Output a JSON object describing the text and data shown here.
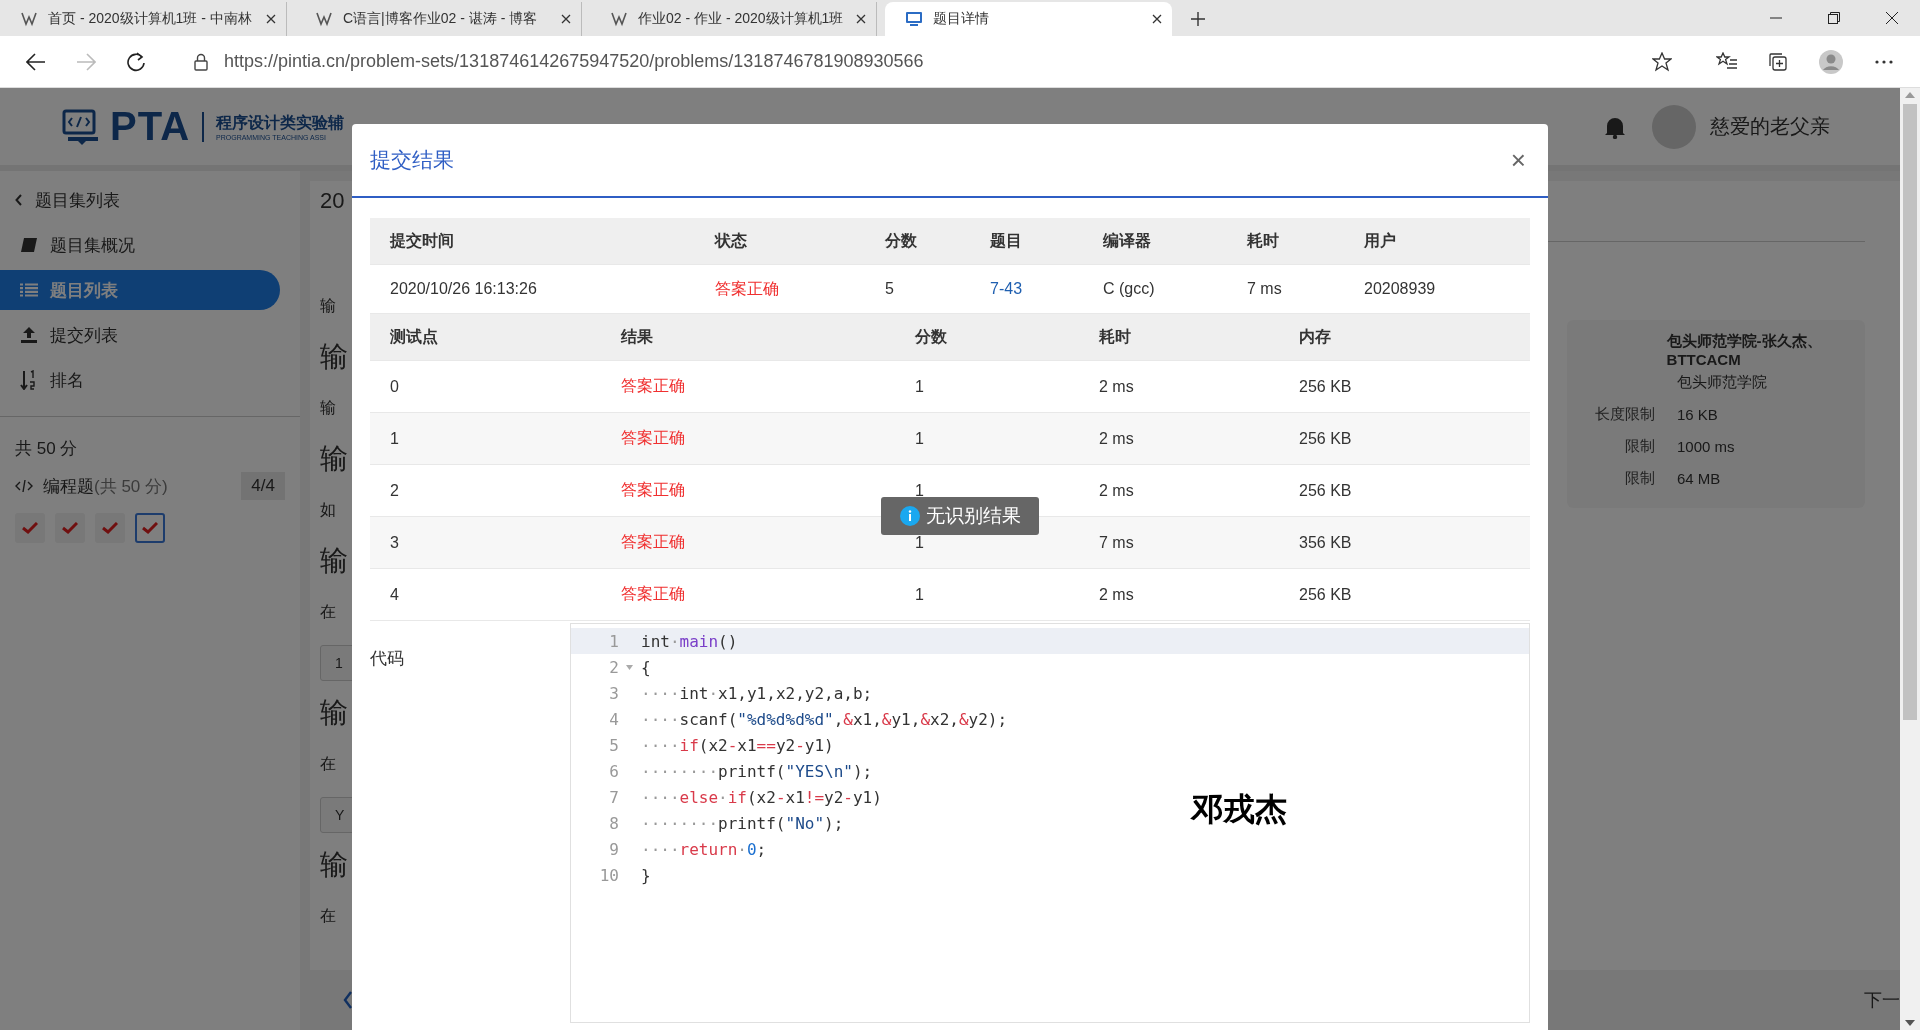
{
  "browser": {
    "tabs": [
      {
        "title": "首页 - 2020级计算机1班 - 中南林",
        "kind": "site",
        "selected": false
      },
      {
        "title": "C语言|博客作业02 - 谌涛 - 博客",
        "kind": "site",
        "selected": false
      },
      {
        "title": "作业02 - 作业 - 2020级计算机1班",
        "kind": "site",
        "selected": false
      },
      {
        "title": "题目详情",
        "kind": "app",
        "selected": true
      }
    ],
    "url": "https://pintia.cn/problem-sets/1318746142675947520/problems/1318746781908930566"
  },
  "header": {
    "logo": "PTA",
    "platform": "程序设计类实验辅",
    "platform_en": "PROGRAMMING TEACHING ASSI",
    "user": "慈爱的老父亲"
  },
  "sidebar": {
    "items": [
      {
        "label": "题目集列表",
        "kind": "back",
        "selected": false
      },
      {
        "label": "题目集概况",
        "kind": "book",
        "selected": false
      },
      {
        "label": "题目列表",
        "kind": "list",
        "selected": true
      },
      {
        "label": "提交列表",
        "kind": "upload",
        "selected": false
      },
      {
        "label": "排名",
        "kind": "sort",
        "selected": false
      }
    ],
    "total": "共 50 分",
    "section": "编程题",
    "section_score": "(共 50 分)",
    "progress": "4/4",
    "problems": [
      {
        "checked": true,
        "selected": false
      },
      {
        "checked": true,
        "selected": false
      },
      {
        "checked": true,
        "selected": false
      },
      {
        "checked": true,
        "selected": true
      }
    ]
  },
  "problem_strip": [
    {
      "text": "20",
      "kind": "title"
    },
    {
      "text": "输",
      "kind": "text"
    },
    {
      "text": "输",
      "kind": "heading"
    },
    {
      "text": "输",
      "kind": "text"
    },
    {
      "text": "输",
      "kind": "heading"
    },
    {
      "text": "如",
      "kind": "text"
    },
    {
      "text": "输",
      "kind": "heading"
    },
    {
      "text": "在",
      "kind": "text"
    },
    {
      "text": "1",
      "kind": "box"
    },
    {
      "text": "输",
      "kind": "heading"
    },
    {
      "text": "在",
      "kind": "text"
    },
    {
      "text": "Y",
      "kind": "box"
    },
    {
      "text": "输",
      "kind": "heading"
    },
    {
      "text": "在",
      "kind": "text"
    }
  ],
  "info": {
    "rows": [
      {
        "value": "包头师范学院-张久杰、BTTCACM",
        "bold": true
      },
      {
        "value": "包头师范学院",
        "bold": false
      },
      {
        "label": "长度限制",
        "value": "16 KB",
        "bold": false
      },
      {
        "label": "限制",
        "value": "1000 ms",
        "bold": false
      },
      {
        "label": "限制",
        "value": "64 MB",
        "bold": false
      }
    ]
  },
  "next_link": "下一",
  "modal": {
    "title": "提交结果",
    "close": "×",
    "summary": {
      "columns": [
        "提交时间",
        "状态",
        "分数",
        "题目",
        "编译器",
        "耗时",
        "用户"
      ],
      "row": [
        {
          "text": "2020/10/26 16:13:26",
          "kind": "plain"
        },
        {
          "text": "答案正确",
          "kind": "status"
        },
        {
          "text": "5",
          "kind": "plain"
        },
        {
          "text": "7-43",
          "kind": "link"
        },
        {
          "text": "C (gcc)",
          "kind": "plain"
        },
        {
          "text": "7 ms",
          "kind": "plain"
        },
        {
          "text": "20208939",
          "kind": "plain"
        }
      ]
    },
    "tests": {
      "columns": [
        "测试点",
        "结果",
        "分数",
        "耗时",
        "内存"
      ],
      "rows": [
        [
          "0",
          "答案正确",
          "1",
          "2 ms",
          "256 KB"
        ],
        [
          "1",
          "答案正确",
          "1",
          "2 ms",
          "256 KB"
        ],
        [
          "2",
          "答案正确",
          "1",
          "2 ms",
          "256 KB"
        ],
        [
          "3",
          "答案正确",
          "1",
          "7 ms",
          "356 KB"
        ],
        [
          "4",
          "答案正确",
          "1",
          "2 ms",
          "256 KB"
        ]
      ]
    },
    "code_label": "代码",
    "code": [
      {
        "no": "1",
        "tokens": [
          {
            "text": "int",
            "kind": "plain"
          },
          {
            "text": "·",
            "kind": "space"
          },
          {
            "text": "main",
            "kind": "function"
          },
          {
            "text": "()",
            "kind": "plain"
          }
        ],
        "active": true,
        "fold": false
      },
      {
        "no": "2",
        "tokens": [
          {
            "text": "{",
            "kind": "plain"
          }
        ],
        "active": false,
        "fold": true
      },
      {
        "no": "3",
        "tokens": [
          {
            "text": "····",
            "kind": "space"
          },
          {
            "text": "int",
            "kind": "plain"
          },
          {
            "text": "·",
            "kind": "space"
          },
          {
            "text": "x1,y1,x2,y2,a,b;",
            "kind": "plain"
          }
        ],
        "active": false,
        "fold": false
      },
      {
        "no": "4",
        "tokens": [
          {
            "text": "····",
            "kind": "space"
          },
          {
            "text": "scanf(",
            "kind": "plain"
          },
          {
            "text": "\"%d%d%d%d\"",
            "kind": "string"
          },
          {
            "text": ",",
            "kind": "plain"
          },
          {
            "text": "&",
            "kind": "operator"
          },
          {
            "text": "x1,",
            "kind": "plain"
          },
          {
            "text": "&",
            "kind": "operator"
          },
          {
            "text": "y1,",
            "kind": "plain"
          },
          {
            "text": "&",
            "kind": "operator"
          },
          {
            "text": "x2,",
            "kind": "plain"
          },
          {
            "text": "&",
            "kind": "operator"
          },
          {
            "text": "y2);",
            "kind": "plain"
          }
        ],
        "active": false,
        "fold": false
      },
      {
        "no": "5",
        "tokens": [
          {
            "text": "····",
            "kind": "space"
          },
          {
            "text": "if",
            "kind": "keyword"
          },
          {
            "text": "(x2",
            "kind": "plain"
          },
          {
            "text": "-",
            "kind": "operator"
          },
          {
            "text": "x1",
            "kind": "plain"
          },
          {
            "text": "==",
            "kind": "operator"
          },
          {
            "text": "y2",
            "kind": "plain"
          },
          {
            "text": "-",
            "kind": "operator"
          },
          {
            "text": "y1)",
            "kind": "plain"
          }
        ],
        "active": false,
        "fold": false
      },
      {
        "no": "6",
        "tokens": [
          {
            "text": "········",
            "kind": "space"
          },
          {
            "text": "printf(",
            "kind": "plain"
          },
          {
            "text": "\"YES\\n\"",
            "kind": "string"
          },
          {
            "text": ");",
            "kind": "plain"
          }
        ],
        "active": false,
        "fold": false
      },
      {
        "no": "7",
        "tokens": [
          {
            "text": "····",
            "kind": "space"
          },
          {
            "text": "else",
            "kind": "keyword"
          },
          {
            "text": "·",
            "kind": "space"
          },
          {
            "text": "if",
            "kind": "keyword"
          },
          {
            "text": "(x2",
            "kind": "plain"
          },
          {
            "text": "-",
            "kind": "operator"
          },
          {
            "text": "x1",
            "kind": "plain"
          },
          {
            "text": "!=",
            "kind": "operator"
          },
          {
            "text": "y2",
            "kind": "plain"
          },
          {
            "text": "-",
            "kind": "operator"
          },
          {
            "text": "y1)",
            "kind": "plain"
          }
        ],
        "active": false,
        "fold": false
      },
      {
        "no": "8",
        "tokens": [
          {
            "text": "········",
            "kind": "space"
          },
          {
            "text": "printf(",
            "kind": "plain"
          },
          {
            "text": "\"No\"",
            "kind": "string"
          },
          {
            "text": ");",
            "kind": "plain"
          }
        ],
        "active": false,
        "fold": false
      },
      {
        "no": "9",
        "tokens": [
          {
            "text": "····",
            "kind": "space"
          },
          {
            "text": "return",
            "kind": "keyword"
          },
          {
            "text": "·",
            "kind": "space"
          },
          {
            "text": "0",
            "kind": "number"
          },
          {
            "text": ";",
            "kind": "plain"
          }
        ],
        "active": false,
        "fold": false
      },
      {
        "no": "10",
        "tokens": [
          {
            "text": "}",
            "kind": "plain"
          }
        ],
        "active": false,
        "fold": false
      }
    ],
    "overlay_text": "邓戎杰"
  },
  "toast": {
    "text": "无识别结果"
  }
}
